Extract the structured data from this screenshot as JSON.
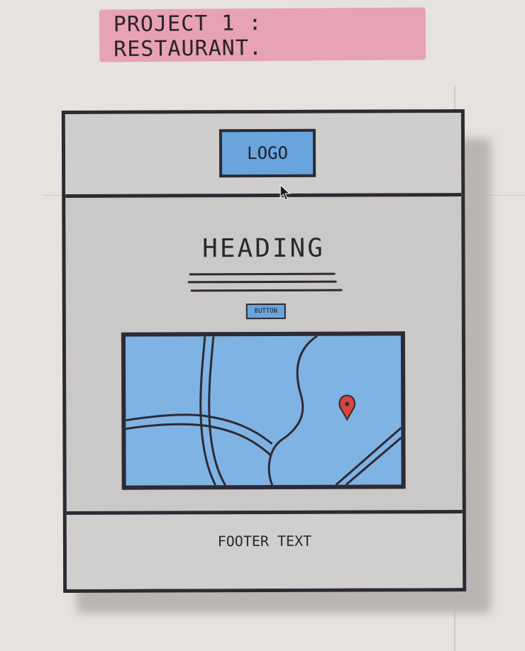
{
  "title": "PROJECT 1 : RESTAURANT.",
  "wireframe": {
    "logo_label": "LOGO",
    "heading": "HEADING",
    "button_label": "BUTTON",
    "footer_text": "FOOTER TEXT"
  },
  "colors": {
    "banner": "#e7a2b5",
    "placeholder_blue": "#6aa4dc",
    "map_blue": "#7fb3e3",
    "pin_red": "#d9443f",
    "ink": "#2e2a33"
  },
  "icons": [
    "cursor-arrow-icon",
    "map-pin-icon"
  ]
}
